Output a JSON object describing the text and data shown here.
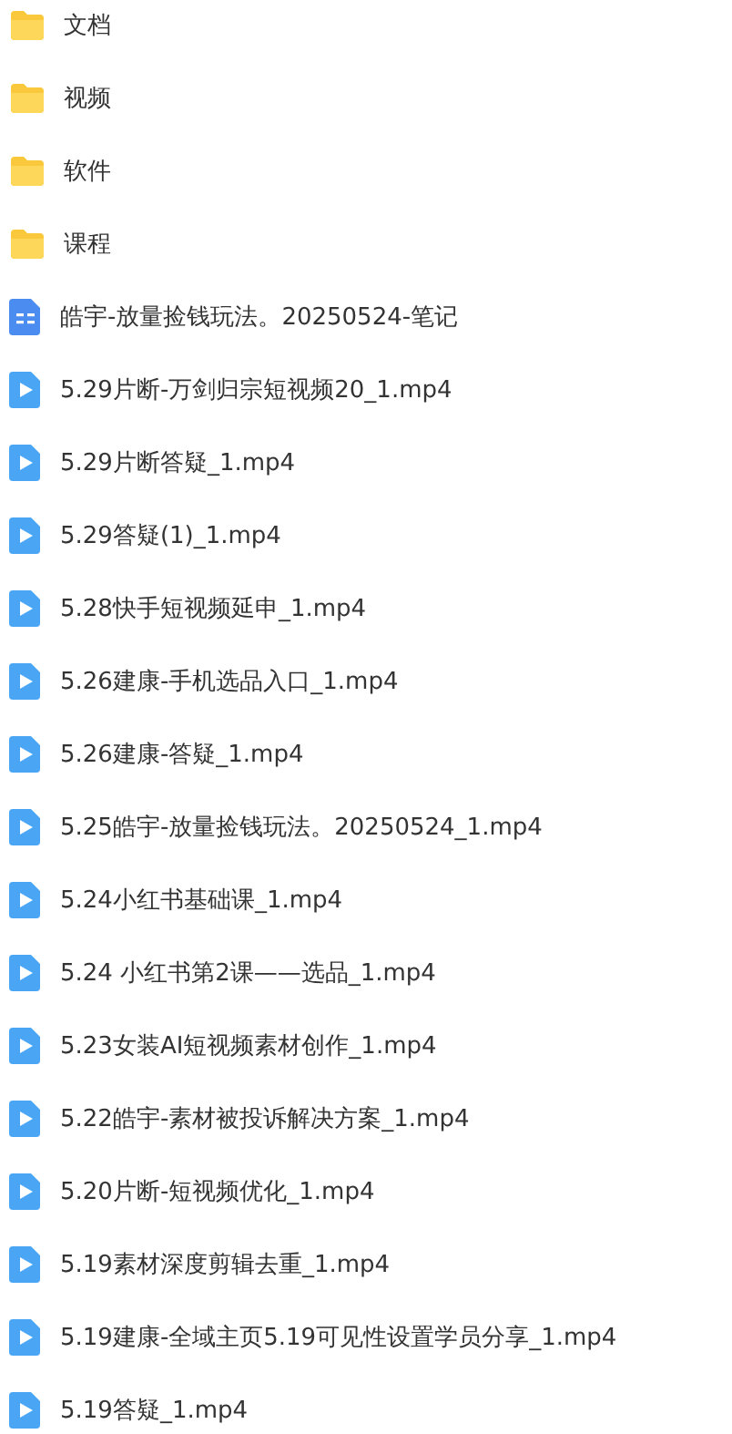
{
  "files": [
    {
      "kind": "folder",
      "name": "文档"
    },
    {
      "kind": "folder",
      "name": "视频"
    },
    {
      "kind": "folder",
      "name": "软件"
    },
    {
      "kind": "folder",
      "name": "课程"
    },
    {
      "kind": "note",
      "name": "皓宇-放量捡钱玩法。20250524-笔记"
    },
    {
      "kind": "video",
      "name": "5.29片断-万剑归宗短视频20_1.mp4"
    },
    {
      "kind": "video",
      "name": "5.29片断答疑_1.mp4"
    },
    {
      "kind": "video",
      "name": "5.29答疑(1)_1.mp4"
    },
    {
      "kind": "video",
      "name": "5.28快手短视频延申_1.mp4"
    },
    {
      "kind": "video",
      "name": "5.26建康-手机选品入口_1.mp4"
    },
    {
      "kind": "video",
      "name": "5.26建康-答疑_1.mp4"
    },
    {
      "kind": "video",
      "name": "5.25皓宇-放量捡钱玩法。20250524_1.mp4"
    },
    {
      "kind": "video",
      "name": "5.24小红书基础课_1.mp4"
    },
    {
      "kind": "video",
      "name": "5.24 小红书第2课——选品_1.mp4"
    },
    {
      "kind": "video",
      "name": "5.23女装AI短视频素材创作_1.mp4"
    },
    {
      "kind": "video",
      "name": "5.22皓宇-素材被投诉解决方案_1.mp4"
    },
    {
      "kind": "video",
      "name": "5.20片断-短视频优化_1.mp4"
    },
    {
      "kind": "video",
      "name": "5.19素材深度剪辑去重_1.mp4"
    },
    {
      "kind": "video",
      "name": "5.19建康-全域主页5.19可见性设置学员分享_1.mp4"
    },
    {
      "kind": "video",
      "name": "5.19答疑_1.mp4"
    }
  ]
}
